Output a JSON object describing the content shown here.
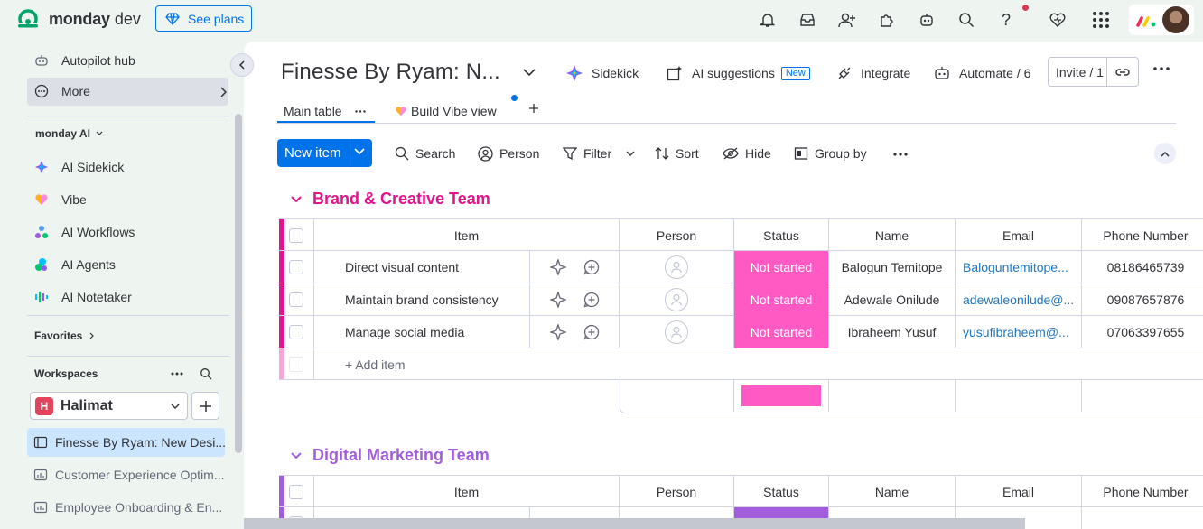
{
  "app": {
    "brand": "monday",
    "product": "dev",
    "see_plans": "See plans"
  },
  "sidebar": {
    "items": [
      {
        "label": "Autopilot hub",
        "icon": "robot-icon"
      },
      {
        "label": "More",
        "icon": "more-circle-icon"
      }
    ],
    "monday_ai_heading": "monday AI",
    "ai_items": [
      {
        "label": "AI Sidekick",
        "icon": "sidekick-icon"
      },
      {
        "label": "Vibe",
        "icon": "vibe-heart-icon"
      },
      {
        "label": "AI Workflows",
        "icon": "workflows-icon"
      },
      {
        "label": "AI Agents",
        "icon": "agents-icon"
      },
      {
        "label": "AI Notetaker",
        "icon": "notetaker-icon"
      }
    ],
    "favorites_heading": "Favorites",
    "workspaces_heading": "Workspaces",
    "workspace": {
      "initial": "H",
      "name": "Halimat"
    },
    "boards": [
      {
        "label": "Finesse By Ryam: New Desi..."
      },
      {
        "label": "Customer Experience Optim..."
      },
      {
        "label": "Employee Onboarding & En..."
      }
    ]
  },
  "header": {
    "title": "Finesse By Ryam: N...",
    "sidekick": "Sidekick",
    "ai_suggestions": "AI suggestions",
    "new_badge": "New",
    "integrate": "Integrate",
    "automate": "Automate / 6",
    "invite": "Invite / 1"
  },
  "tabs": [
    {
      "label": "Main table"
    },
    {
      "label": "Build Vibe view"
    }
  ],
  "toolbar": {
    "new_item": "New item",
    "search": "Search",
    "person": "Person",
    "filter": "Filter",
    "sort": "Sort",
    "hide": "Hide",
    "group_by": "Group by"
  },
  "columns": [
    "Item",
    "Person",
    "Status",
    "Name",
    "Email",
    "Phone Number"
  ],
  "groups": [
    {
      "title": "Brand & Creative Team",
      "color": "#e2148c",
      "rows": [
        {
          "item": "Direct visual content",
          "status": "Not started",
          "name": "Balogun Temitope",
          "email": "Baloguntemitope...",
          "phone": "08186465739"
        },
        {
          "item": "Maintain brand consistency",
          "status": "Not started",
          "name": "Adewale Onilude",
          "email": "adewaleonilude@...",
          "phone": "09087657876"
        },
        {
          "item": "Manage social media",
          "status": "Not started",
          "name": "Ibraheem Yusuf",
          "email": "yusufibraheem@...",
          "phone": "07063397655"
        }
      ],
      "add_item": "+ Add item"
    },
    {
      "title": "Digital Marketing Team",
      "color": "#a25ddc",
      "rows": []
    }
  ],
  "colors": {
    "accent": "#0073ea",
    "status_not_started": "#ff5ac4"
  }
}
